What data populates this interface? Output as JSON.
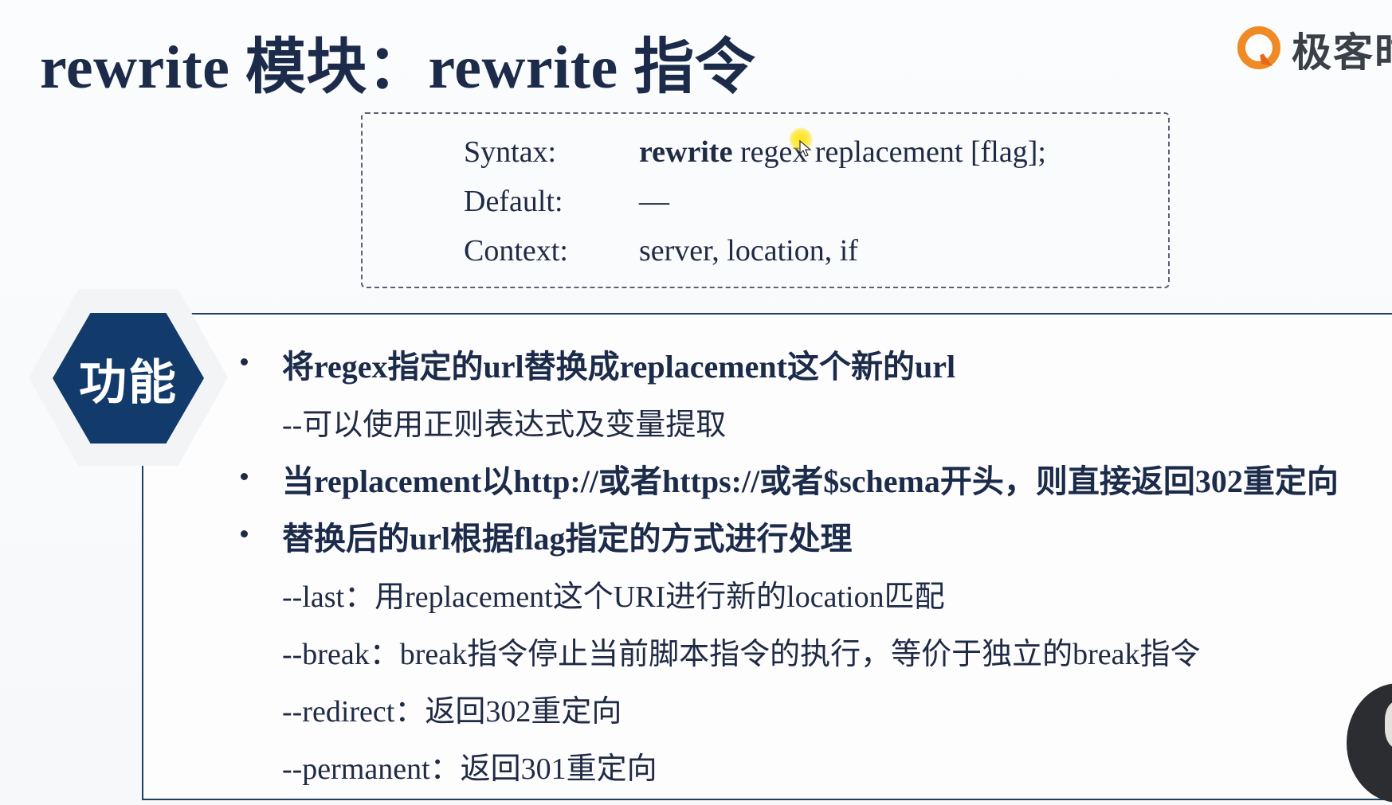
{
  "title": "rewrite 模块：rewrite 指令",
  "logo": {
    "text": "极客时",
    "icon": "geektime-logo-icon",
    "colors": {
      "mark": "#f08a24",
      "text": "#3a3f48"
    }
  },
  "syntax": {
    "syntax_label": "Syntax:",
    "syntax_keyword": "rewrite",
    "syntax_rest": " regex replacement [flag];",
    "default_label": "Default:",
    "default_value": "—",
    "context_label": "Context:",
    "context_value": "server, location, if"
  },
  "badge": {
    "label": "功能",
    "color": "#123a6a"
  },
  "bullets": [
    {
      "text": "将regex指定的url替换成replacement这个新的url",
      "subs": [
        "--可以使用正则表达式及变量提取"
      ]
    },
    {
      "text": "当replacement以http://或者https://或者$schema开头，则直接返回302重定向",
      "subs": []
    },
    {
      "text": "替换后的url根据flag指定的方式进行处理",
      "subs": [
        "--last：用replacement这个URI进行新的location匹配",
        "--break：break指令停止当前脚本指令的执行，等价于独立的break指令",
        "--redirect：返回302重定向",
        "--permanent：返回301重定向"
      ]
    }
  ],
  "colors": {
    "title": "#1c2b4a",
    "panel_border": "#1e3f66",
    "cursor_highlight": "#ffe100"
  }
}
